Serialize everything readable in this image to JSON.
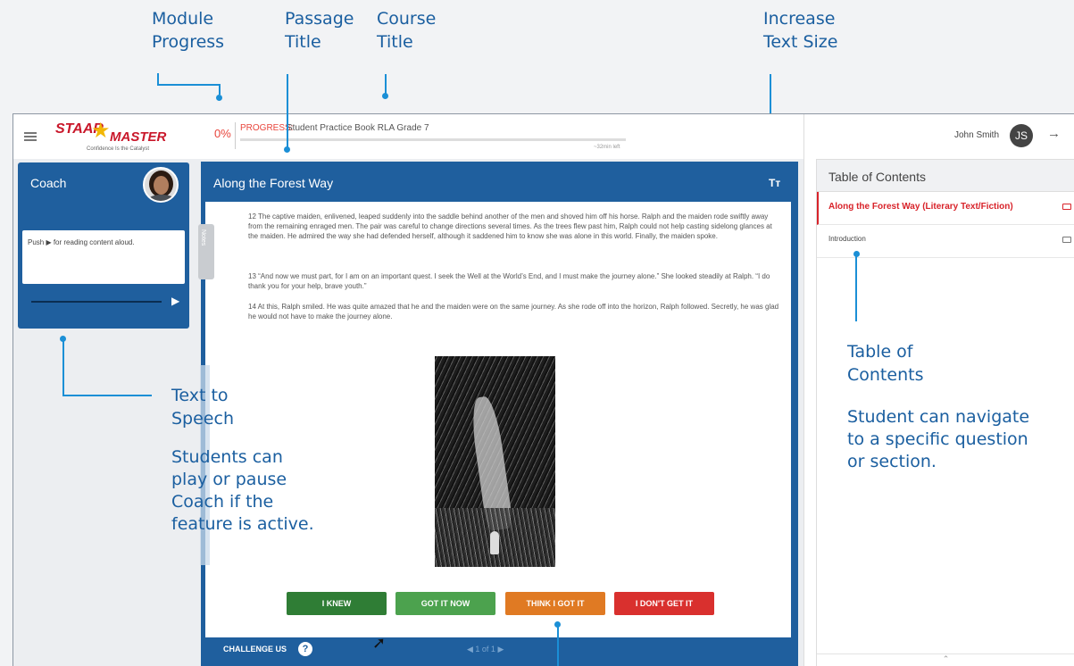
{
  "annotations": {
    "module_progress": {
      "line1": "Module",
      "line2": "Progress"
    },
    "passage_title": {
      "line1": "Passage",
      "line2": "Title"
    },
    "course_title": {
      "line1": "Course",
      "line2": "Title"
    },
    "increase_text": {
      "line1": "Increase",
      "line2": "Text Size"
    },
    "tts": {
      "title1": "Text to",
      "title2": "Speech",
      "desc": [
        "Students can",
        "play or pause",
        "Coach if the",
        "feature is active."
      ]
    },
    "toc": {
      "title1": "Table of",
      "title2": "Contents",
      "desc": [
        "Student can navigate",
        "to a specific question",
        "or section."
      ]
    }
  },
  "header": {
    "logo_word1": "STAAR",
    "logo_word2": "MASTER",
    "logo_tagline": "Confidence Is the Catalyst",
    "progress_percent": "0%",
    "progress_label": "PROGRESS:",
    "course_title": "Student Practice Book RLA Grade 7",
    "time_left": "~32min left",
    "progress_value": 0,
    "user_name": "John Smith",
    "user_initials": "JS"
  },
  "coach": {
    "title": "Coach",
    "message": "Push  ▶  for reading content aloud."
  },
  "passage": {
    "title": "Along the Forest Way",
    "text_size_icon": "Tᴛ",
    "notes_label": "Notes",
    "paragraphs": [
      "12  The captive maiden, enlivened, leaped suddenly into the saddle behind another of the men and shoved him off his horse. Ralph and the maiden rode swiftly away from the remaining enraged men. The pair was careful to change directions several times. As the trees flew past him, Ralph could not help casting sidelong glances at the maiden. He admired the way she had defended herself, although it saddened him to know she was alone in this world. Finally, the maiden spoke.",
      "13  “And now we must part, for I am on an important quest. I seek the Well at the World’s End, and I must make the journey alone.” She looked steadily at Ralph. “I do thank you for your help, brave youth.”",
      "14  At this, Ralph smiled. He was quite amazed that he and the maiden were on the same journey. As she rode off into the horizon, Ralph followed. Secretly, he was glad he would not have to make the journey alone."
    ],
    "buttons": {
      "knew": "I KNEW",
      "got_it_now": "GOT IT NOW",
      "think_got_it": "THINK I GOT IT",
      "dont_get_it": "I DON'T GET IT"
    },
    "challenge_label": "CHALLENGE US",
    "help_icon": "?",
    "pager": "1 of 1"
  },
  "toc": {
    "title": "Table of Contents",
    "items": [
      {
        "label": "Along the Forest Way (Literary Text/Fiction)",
        "active": true
      },
      {
        "label": "Introduction",
        "active": false
      }
    ],
    "collapse_icon": "chevron-up-icon"
  },
  "colors": {
    "panel_blue": "#1f5f9e",
    "accent_red": "#d8232a",
    "knew_green": "#2f7d35",
    "got_it_green": "#4ca24e",
    "think_orange": "#e07a23",
    "dont_red": "#d9302e",
    "annotation_blue": "#1b5fa0"
  }
}
